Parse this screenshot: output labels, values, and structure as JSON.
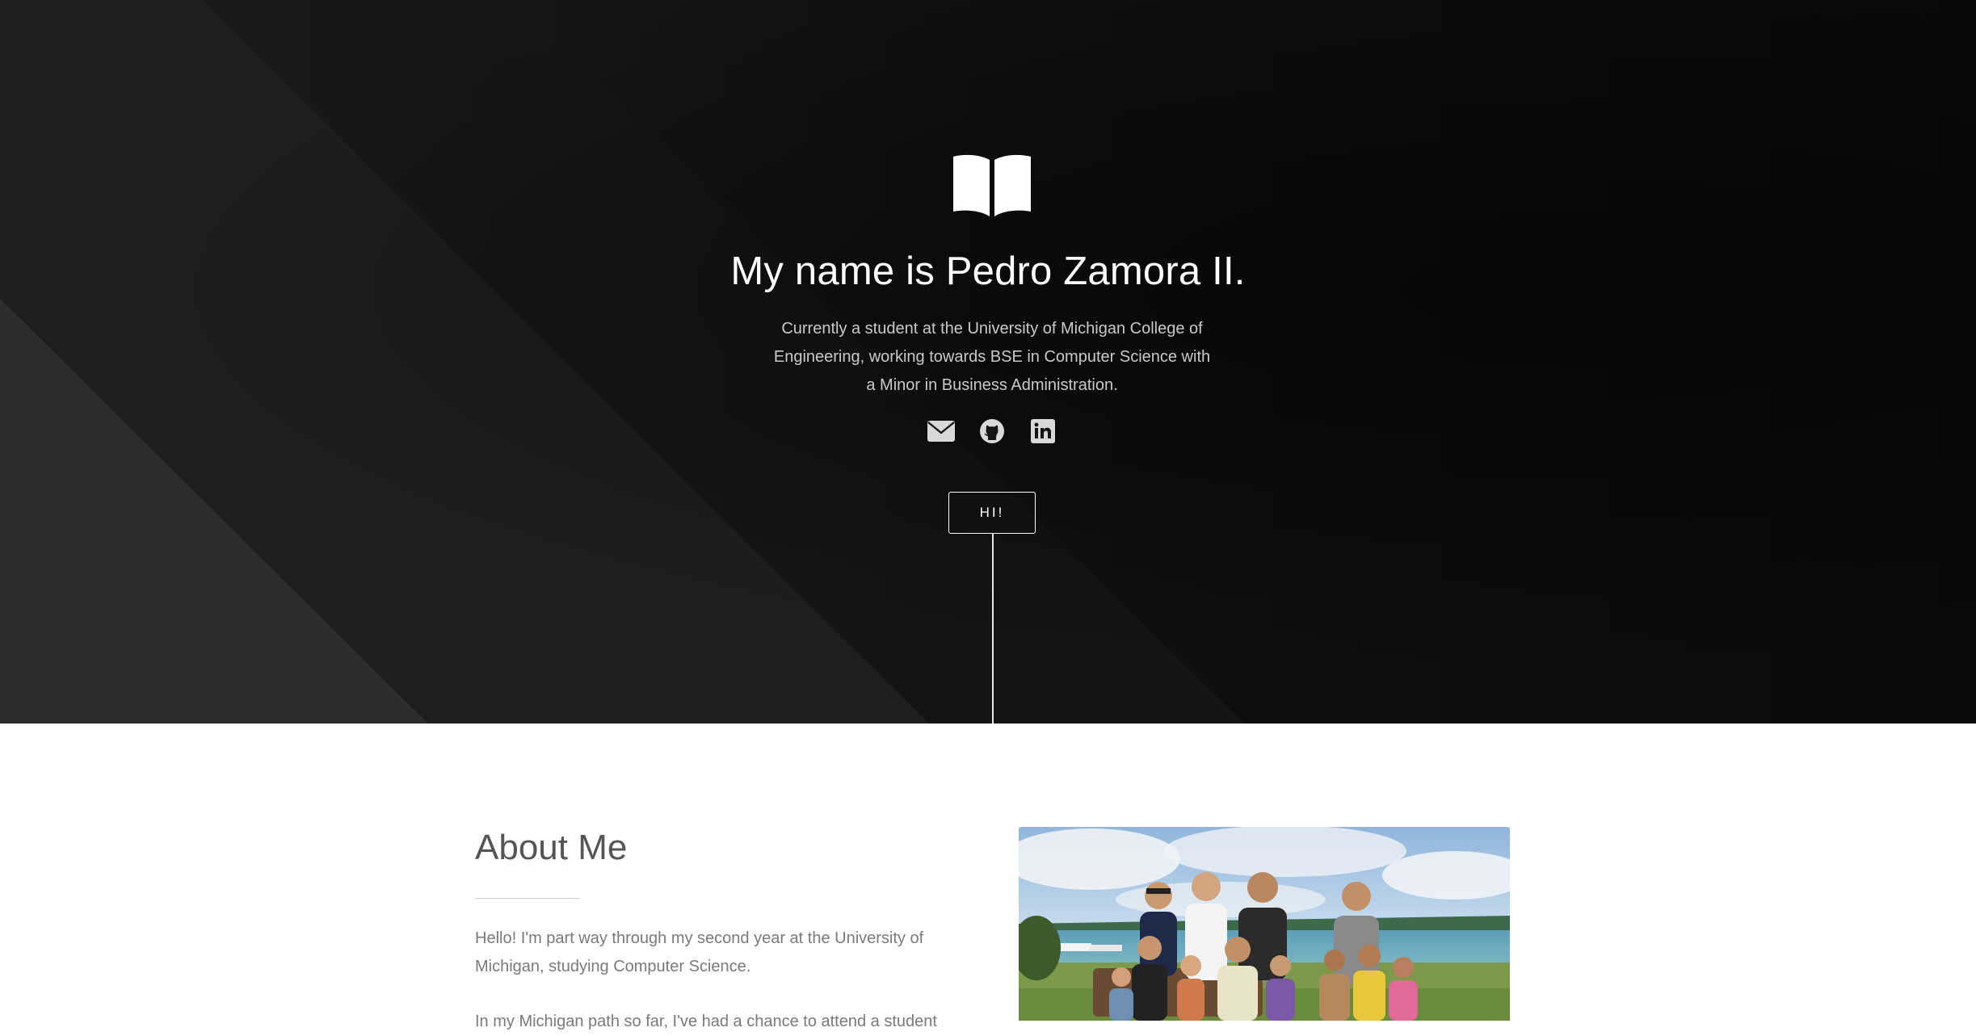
{
  "hero": {
    "icon": "open-book-icon",
    "title_prefix": "My name is ",
    "title_name": "Pedro Zamora II",
    "title_suffix": ".",
    "subtitle": "Currently a student at the University of Michigan College of Engineering, working towards BSE in Computer Science with a Minor in Business Administration.",
    "social": [
      {
        "name": "email",
        "icon": "envelope-icon"
      },
      {
        "name": "github",
        "icon": "github-icon"
      },
      {
        "name": "linkedin",
        "icon": "linkedin-icon"
      }
    ],
    "button_label": "HI!",
    "colors": {
      "background": "#111111",
      "text": "#ffffff",
      "subtitle": "#c9c9c9"
    }
  },
  "about": {
    "heading": "About Me",
    "paragraph_1": "Hello! I'm part way through my second year at the University of Michigan, studying Computer Science.",
    "paragraph_2": "In my Michigan path so far, I've had a chance to attend a student",
    "photo": "group-photo-lakeside"
  }
}
